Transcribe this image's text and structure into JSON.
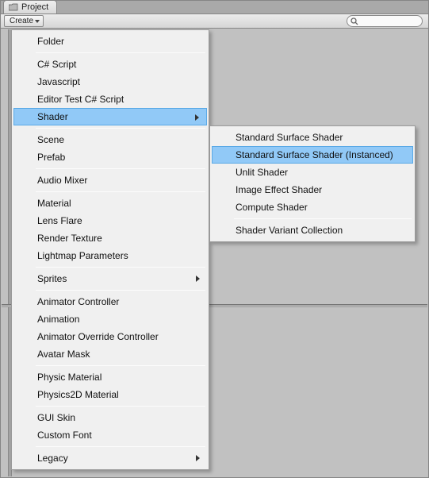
{
  "tab": {
    "title": "Project"
  },
  "toolbar": {
    "create_label": "Create"
  },
  "search": {
    "placeholder": ""
  },
  "menu": {
    "items": [
      {
        "label": "Folder"
      },
      {
        "label": "C# Script"
      },
      {
        "label": "Javascript"
      },
      {
        "label": "Editor Test C# Script"
      },
      {
        "label": "Shader"
      },
      {
        "label": "Scene"
      },
      {
        "label": "Prefab"
      },
      {
        "label": "Audio Mixer"
      },
      {
        "label": "Material"
      },
      {
        "label": "Lens Flare"
      },
      {
        "label": "Render Texture"
      },
      {
        "label": "Lightmap Parameters"
      },
      {
        "label": "Sprites"
      },
      {
        "label": "Animator Controller"
      },
      {
        "label": "Animation"
      },
      {
        "label": "Animator Override Controller"
      },
      {
        "label": "Avatar Mask"
      },
      {
        "label": "Physic Material"
      },
      {
        "label": "Physics2D Material"
      },
      {
        "label": "GUI Skin"
      },
      {
        "label": "Custom Font"
      },
      {
        "label": "Legacy"
      }
    ]
  },
  "submenu": {
    "items": [
      {
        "label": "Standard Surface Shader"
      },
      {
        "label": "Standard Surface Shader (Instanced)"
      },
      {
        "label": "Unlit Shader"
      },
      {
        "label": "Image Effect Shader"
      },
      {
        "label": "Compute Shader"
      },
      {
        "label": "Shader Variant Collection"
      }
    ]
  }
}
